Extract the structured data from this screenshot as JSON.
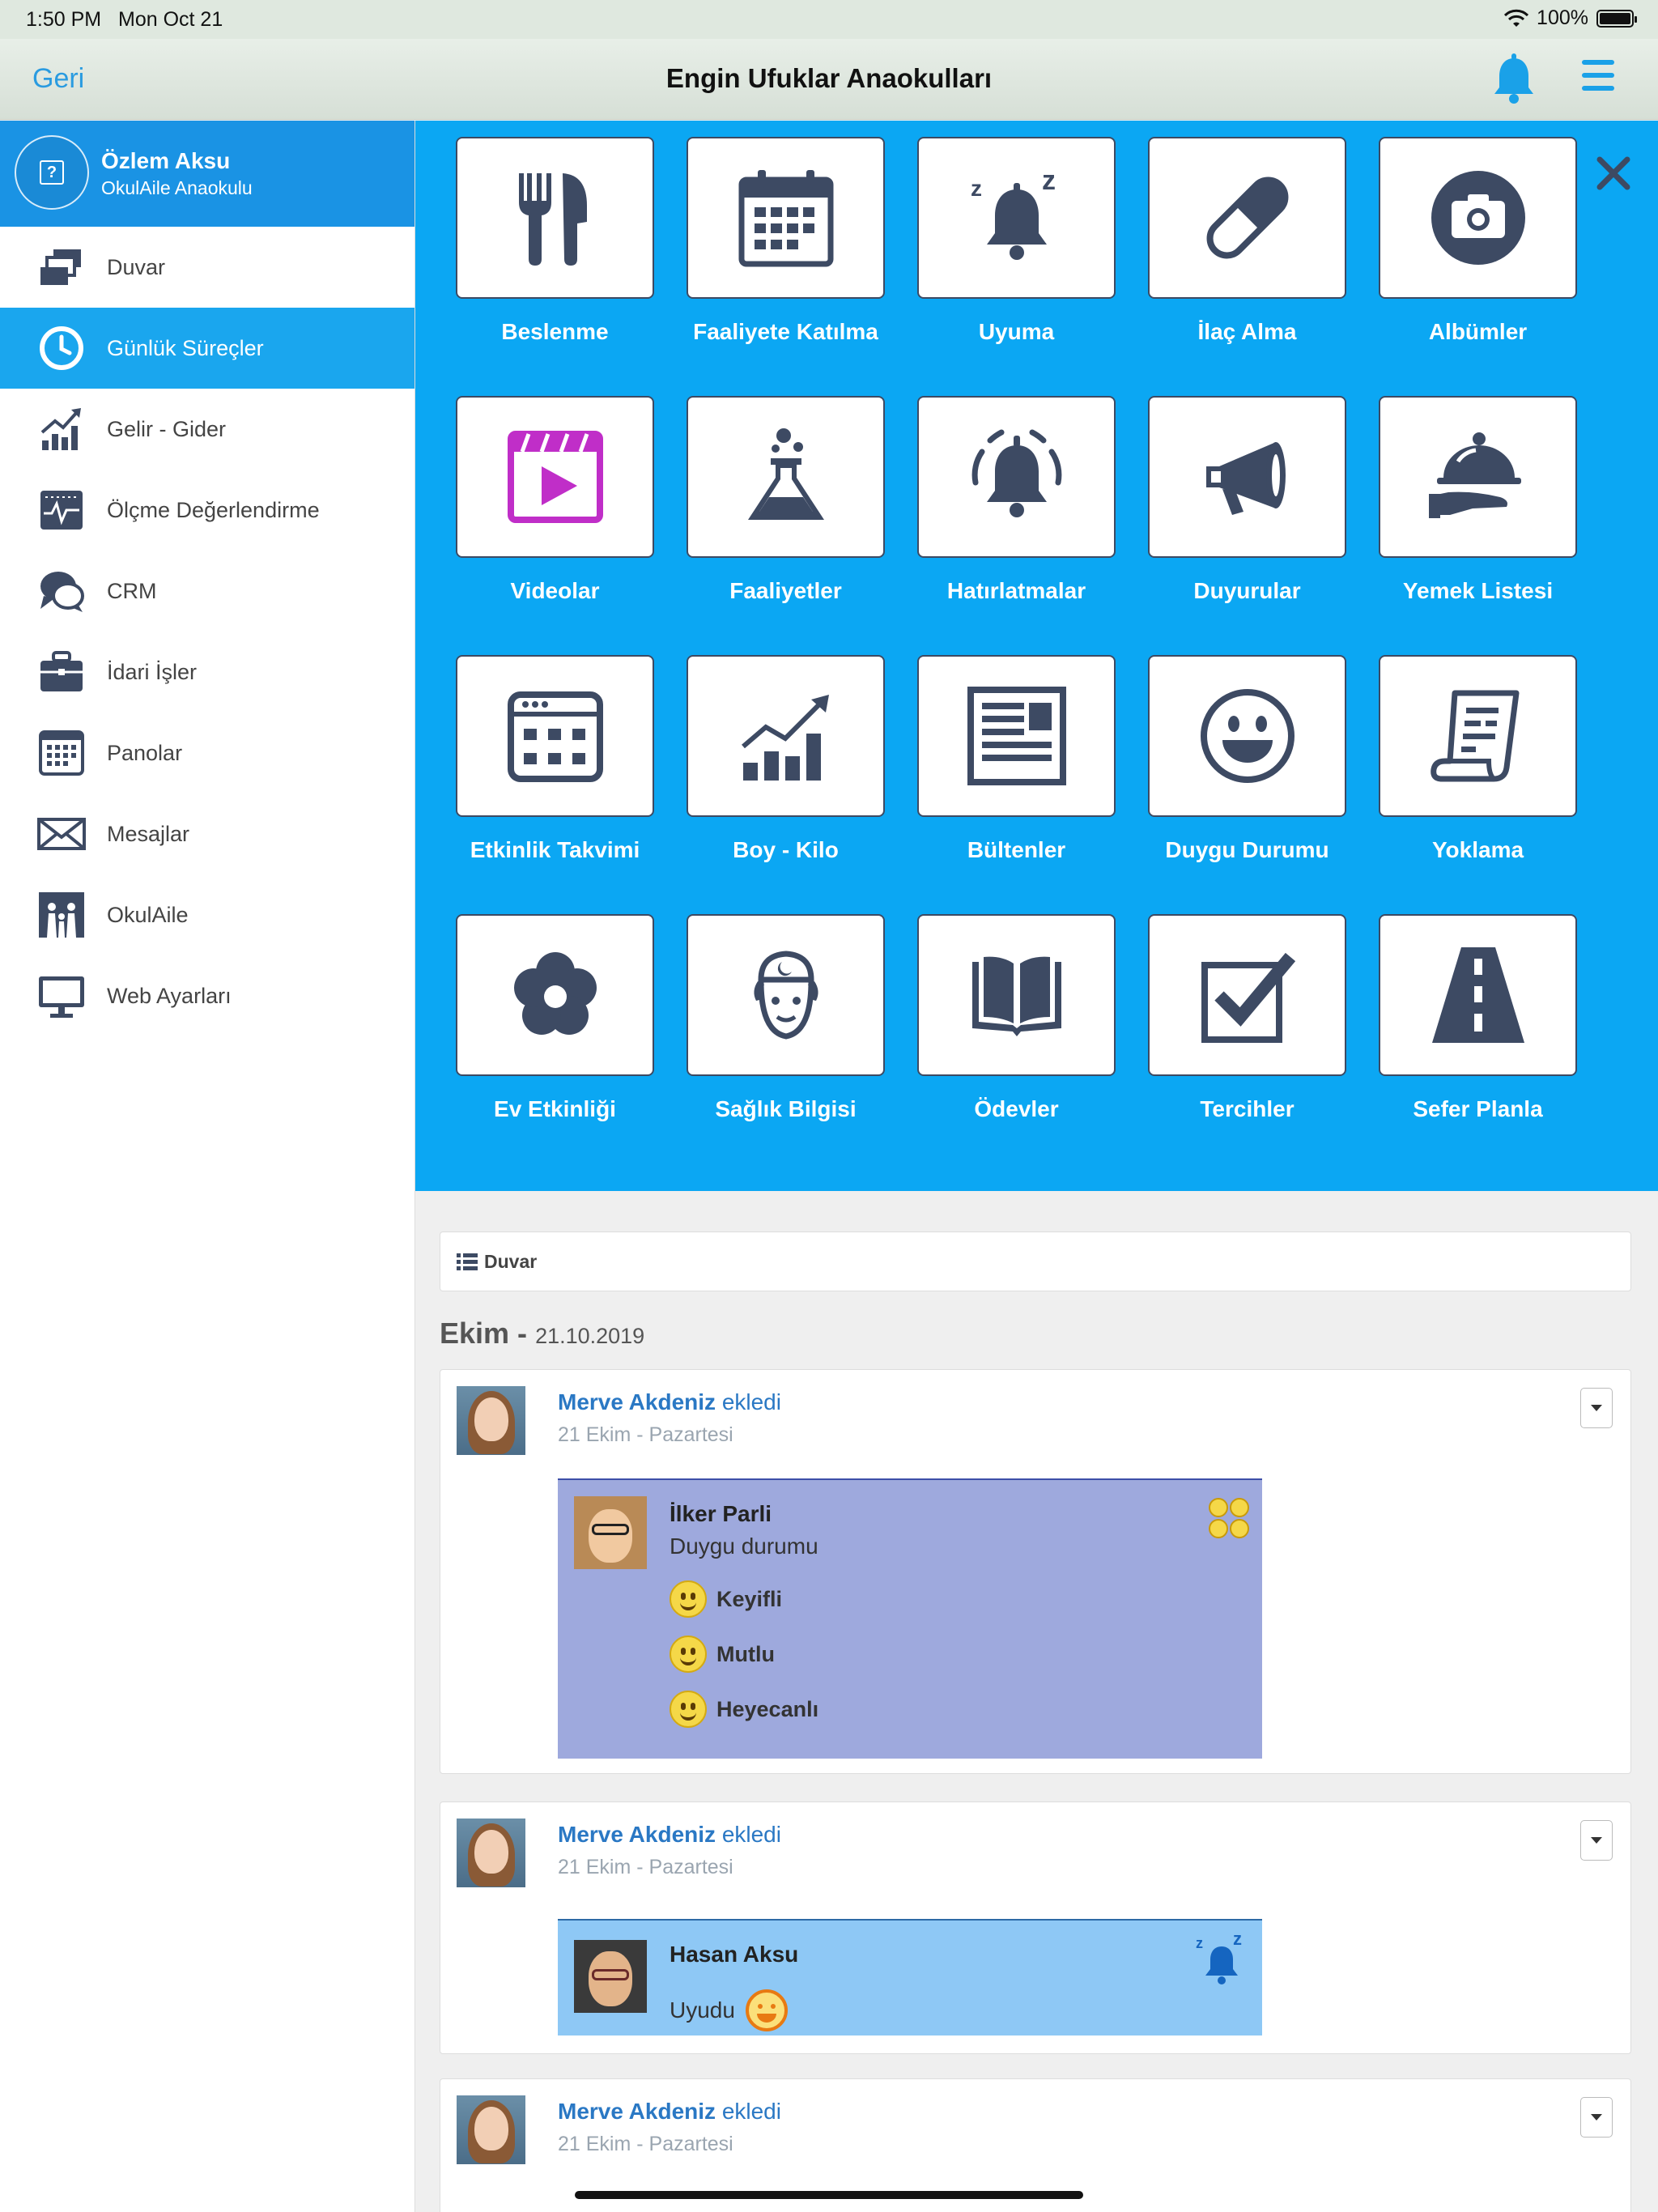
{
  "status": {
    "time": "1:50 PM",
    "date": "Mon Oct 21",
    "battery": "100%"
  },
  "nav": {
    "back_label": "Geri",
    "title": "Engin Ufuklar Anaokulları",
    "bell_icon": "bell-icon",
    "menu_icon": "hamburger-icon"
  },
  "profile": {
    "name": "Özlem Aksu",
    "school": "OkulAile Anaokulu"
  },
  "sidebar": {
    "items": [
      {
        "label": "Duvar",
        "icon": "wall-icon",
        "active": false
      },
      {
        "label": "Günlük Süreçler",
        "icon": "clock-icon",
        "active": true
      },
      {
        "label": "Gelir - Gider",
        "icon": "chart-icon",
        "active": false
      },
      {
        "label": "Ölçme Değerlendirme",
        "icon": "measure-icon",
        "active": false
      },
      {
        "label": "CRM",
        "icon": "chat-icon",
        "active": false
      },
      {
        "label": "İdari İşler",
        "icon": "briefcase-icon",
        "active": false
      },
      {
        "label": "Panolar",
        "icon": "board-icon",
        "active": false
      },
      {
        "label": "Mesajlar",
        "icon": "mail-icon",
        "active": false
      },
      {
        "label": "OkulAile",
        "icon": "family-icon",
        "active": false
      },
      {
        "label": "Web Ayarları",
        "icon": "monitor-icon",
        "active": false
      }
    ]
  },
  "grid": {
    "tiles": [
      {
        "label": "Beslenme",
        "icon": "cutlery-icon"
      },
      {
        "label": "Faaliyete Katılma",
        "icon": "calendar-icon"
      },
      {
        "label": "Uyuma",
        "icon": "sleep-bell-icon"
      },
      {
        "label": "İlaç Alma",
        "icon": "pill-icon"
      },
      {
        "label": "Albümler",
        "icon": "camera-icon"
      },
      {
        "label": "Videolar",
        "icon": "video-icon"
      },
      {
        "label": "Faaliyetler",
        "icon": "flask-icon"
      },
      {
        "label": "Hatırlatmalar",
        "icon": "ringing-bell-icon"
      },
      {
        "label": "Duyurular",
        "icon": "megaphone-icon"
      },
      {
        "label": "Yemek Listesi",
        "icon": "cloche-icon"
      },
      {
        "label": "Etkinlik Takvimi",
        "icon": "event-calendar-icon"
      },
      {
        "label": "Boy - Kilo",
        "icon": "growth-chart-icon"
      },
      {
        "label": "Bültenler",
        "icon": "newsletter-icon"
      },
      {
        "label": "Duygu Durumu",
        "icon": "smile-icon"
      },
      {
        "label": "Yoklama",
        "icon": "scroll-icon"
      },
      {
        "label": "Ev Etkinliği",
        "icon": "flower-icon"
      },
      {
        "label": "Sağlık Bilgisi",
        "icon": "nurse-icon"
      },
      {
        "label": "Ödevler",
        "icon": "book-icon"
      },
      {
        "label": "Tercihler",
        "icon": "checkbox-icon"
      },
      {
        "label": "Sefer Planla",
        "icon": "road-icon"
      }
    ]
  },
  "feed": {
    "section_label": "Duvar",
    "month": "Ekim -",
    "date": "21.10.2019",
    "posts": [
      {
        "author": "Merve Akdeniz",
        "action": "ekledi",
        "when": "21 Ekim - Pazartesi",
        "child": "İlker Parli",
        "text": "Duygu durumu",
        "moods": [
          "Keyifli",
          "Mutlu",
          "Heyecanlı"
        ]
      },
      {
        "author": "Merve Akdeniz",
        "action": "ekledi",
        "when": "21 Ekim - Pazartesi",
        "child": "Hasan Aksu",
        "text": "Uyudu"
      },
      {
        "author": "Merve Akdeniz",
        "action": "ekledi",
        "when": "21 Ekim - Pazartesi"
      }
    ]
  },
  "colors": {
    "accent": "#0ba7f3",
    "sidebar_active": "#1aa6ee",
    "icon_dark": "#3d4a63",
    "mood_bg": "#9ea9dd",
    "sleep_bg": "#8ec8f5",
    "link": "#2a78c4"
  }
}
